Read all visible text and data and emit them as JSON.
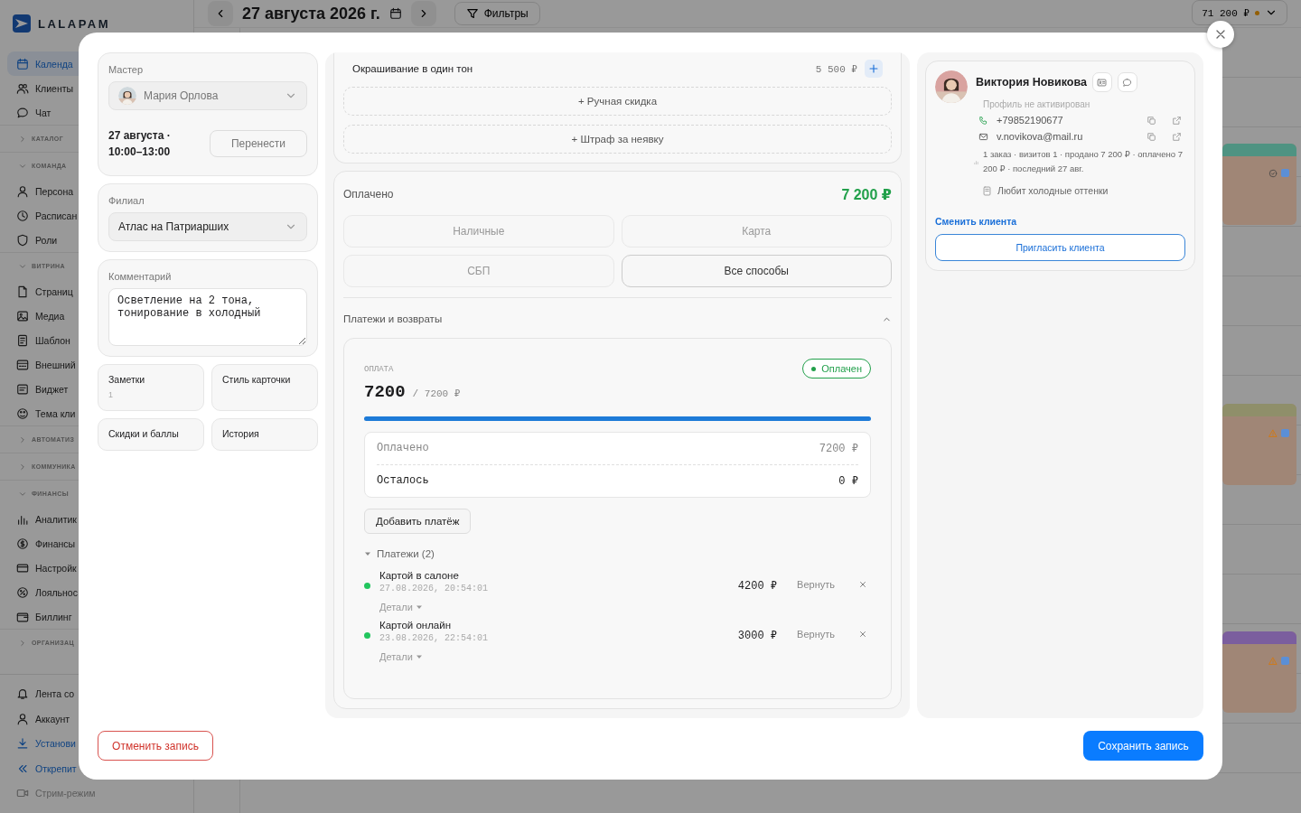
{
  "sidebar": {
    "logo": "LALAPAM",
    "items": [
      {
        "kind": "item",
        "label": "Календа",
        "selected": true
      },
      {
        "kind": "item",
        "label": "Клиенты",
        "selected": false
      },
      {
        "kind": "item",
        "label": "Чат",
        "selected": false
      },
      {
        "kind": "section",
        "label": "КАТАЛОГ",
        "expanded": false
      },
      {
        "kind": "section",
        "label": "КОМАНДА",
        "expanded": true
      },
      {
        "kind": "item",
        "label": "Персона",
        "selected": false
      },
      {
        "kind": "item",
        "label": "Расписан",
        "selected": false
      },
      {
        "kind": "item",
        "label": "Роли",
        "selected": false
      },
      {
        "kind": "section",
        "label": "ВИТРИНА",
        "expanded": true
      },
      {
        "kind": "item",
        "label": "Страниц",
        "selected": false
      },
      {
        "kind": "item",
        "label": "Медиа",
        "selected": false
      },
      {
        "kind": "item",
        "label": "Шаблон",
        "selected": false
      },
      {
        "kind": "item",
        "label": "Внешний",
        "selected": false
      },
      {
        "kind": "item",
        "label": "Виджет",
        "selected": false
      },
      {
        "kind": "item",
        "label": "Тема кли",
        "selected": false
      },
      {
        "kind": "section",
        "label": "АВТОМАТИЗ",
        "expanded": false
      },
      {
        "kind": "section",
        "label": "КОММУНИКА",
        "expanded": false
      },
      {
        "kind": "section",
        "label": "ФИНАНСЫ",
        "expanded": true
      },
      {
        "kind": "item",
        "label": "Аналитик",
        "selected": false
      },
      {
        "kind": "item",
        "label": "Финансы",
        "selected": false
      },
      {
        "kind": "item",
        "label": "Настройк",
        "selected": false
      },
      {
        "kind": "item",
        "label": "Лояльнос",
        "selected": false
      },
      {
        "kind": "item",
        "label": "Биллинг",
        "selected": false
      },
      {
        "kind": "section",
        "label": "ОРГАНИЗАЦ",
        "expanded": false
      }
    ],
    "footer": [
      {
        "label": "Лента со",
        "kind": "plain"
      },
      {
        "label": "Аккаунт",
        "kind": "plain"
      },
      {
        "label": "Установи",
        "kind": "accent"
      },
      {
        "label": "Открепит",
        "kind": "accent"
      },
      {
        "label": "Стрим-режим",
        "kind": "muted"
      }
    ]
  },
  "topbar": {
    "date": "27 августа 2026 г.",
    "filters": "Фильтры",
    "total": "71 200 ₽"
  },
  "events": [
    {
      "color": "#4f9382",
      "kind": "done"
    },
    {
      "color": "#8f8f6a",
      "kind": "warning"
    },
    {
      "color": "#7b5e9e",
      "kind": "warning"
    }
  ],
  "master": {
    "label": "Мастер",
    "name": "Мария Орлова",
    "when": "27 августа · 10:00–13:00",
    "reschedule": "Перенести"
  },
  "branch": {
    "label": "Филиал",
    "value": "Атлас на Патриарших"
  },
  "comment": {
    "label": "Комментарий",
    "value": "Осветление на 2 тона, тонирование в холодный"
  },
  "tiles": [
    {
      "label": "Заметки",
      "count": "1"
    },
    {
      "label": "Стиль карточки"
    },
    {
      "label": "Скидки и баллы"
    },
    {
      "label": "История"
    }
  ],
  "service": {
    "name": "Окрашивание в один тон",
    "price": "5 500 ₽"
  },
  "extras": [
    "+ Ручная скидка",
    "+ Штраф за неявку"
  ],
  "payment": {
    "label": "Оплачено",
    "amount": "7 200 ₽",
    "methods": [
      {
        "label": "Наличные",
        "disabled": true
      },
      {
        "label": "Карта",
        "disabled": true
      },
      {
        "label": "СБП",
        "disabled": true
      },
      {
        "label": "Все способы",
        "disabled": false
      }
    ],
    "history_title": "Платежи и возвраты",
    "history_expanded": true,
    "caption": "ОПЛАТА",
    "status": {
      "label": "Оплачен",
      "kind": "success"
    },
    "paid": "7200",
    "total": "/ 7200 ₽",
    "level": 1,
    "summary": [
      {
        "label": "Оплачено",
        "value": "7200 ₽",
        "muted": true
      },
      {
        "label": "Осталось",
        "value": "0 ₽",
        "muted": false
      }
    ],
    "add": "Добавить платёж",
    "list_title": "Платежи (2)",
    "list_expanded": true,
    "list": [
      {
        "name": "Картой в салоне",
        "date": "27.08.2026, 20:54:01",
        "amount": "4200 ₽",
        "refund": "Вернуть",
        "details": "Детали",
        "color": "#22c55e"
      },
      {
        "name": "Картой онлайн",
        "date": "23.08.2026, 22:54:01",
        "amount": "3000 ₽",
        "refund": "Вернуть",
        "details": "Детали",
        "color": "#22c55e"
      }
    ]
  },
  "client": {
    "name": "Виктория Новикова",
    "profile": "Профиль не активирован",
    "phone": "+79852190677",
    "email": "v.novikova@mail.ru",
    "stats": "1 заказ · визитов 1 · продано 7 200 ₽ · оплачено 7 200 ₽ · последний 27 авг.",
    "note": "Любит холодные оттенки",
    "change": "Сменить клиента",
    "invite": "Пригласить клиента"
  },
  "actions": {
    "cancel": "Отменить запись",
    "save": "Сохранить запись"
  }
}
